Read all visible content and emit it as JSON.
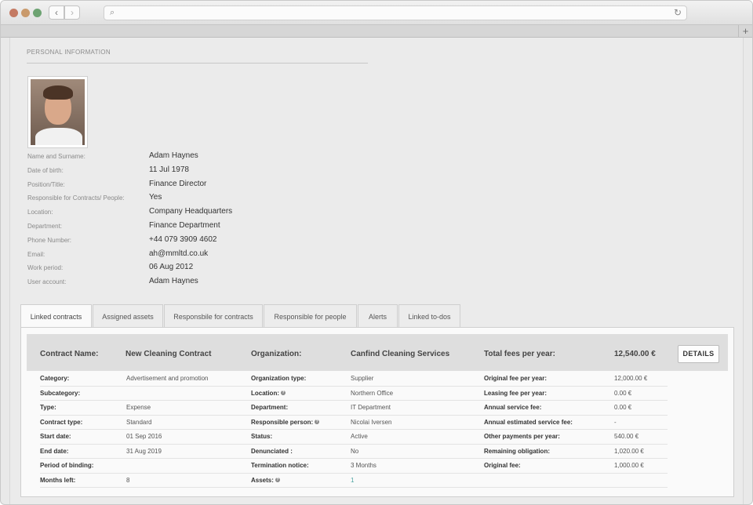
{
  "browser": {
    "back_glyph": "‹",
    "forward_glyph": "›",
    "search_glyph": "⌕",
    "reload_glyph": "↻",
    "new_tab_glyph": "+"
  },
  "section_title": "PERSONAL INFORMATION",
  "person": {
    "fields": [
      {
        "label": "Name and Surname:",
        "value": "Adam Haynes"
      },
      {
        "label": "Date of birth:",
        "value": "11 Jul 1978"
      },
      {
        "label": "Position/Title:",
        "value": "Finance Director"
      },
      {
        "label": "Responsible for Contracts/ People:",
        "value": "Yes"
      },
      {
        "label": "Location:",
        "value": "Company Headquarters"
      },
      {
        "label": "Department:",
        "value": "Finance Department"
      },
      {
        "label": "Phone Number:",
        "value": "+44 079 3909 4602"
      },
      {
        "label": "Email:",
        "value": "ah@mmltd.co.uk"
      },
      {
        "label": "Work period:",
        "value": "06 Aug 2012"
      },
      {
        "label": "User account:",
        "value": "Adam Haynes"
      }
    ]
  },
  "tabs": [
    {
      "label": "Linked contracts",
      "active": true
    },
    {
      "label": "Assigned assets"
    },
    {
      "label": "Responsbile for contracts"
    },
    {
      "label": "Responsible for people"
    },
    {
      "label": "Alerts"
    },
    {
      "label": "Linked to-dos"
    }
  ],
  "contract": {
    "name_label": "Contract Name:",
    "name_value": "New Cleaning Contract",
    "org_label": "Organization:",
    "org_value": "Canfind Cleaning Services",
    "fees_label": "Total fees per year:",
    "fees_value": "12,540.00 €",
    "details_button": "DETAILS"
  },
  "contract_rows": [
    [
      "Category:",
      "Advertisement and promotion",
      "Organization type:",
      "Supplier",
      "Original fee per year:",
      "12,000.00 €"
    ],
    [
      "Subcategory:",
      "",
      "Location:",
      "Northern Office",
      "Leasing fee per year:",
      "0.00 €"
    ],
    [
      "Type:",
      "Expense",
      "Department:",
      "IT Department",
      "Annual service fee:",
      "0.00 €"
    ],
    [
      "Contract type:",
      "Standard",
      "Responsible person:",
      "Nicolai Iversen",
      "Annual estimated service fee:",
      "-"
    ],
    [
      "Start date:",
      "01 Sep 2016",
      "Status:",
      "Active",
      "Other payments per year:",
      "540.00 €"
    ],
    [
      "End date:",
      "31 Aug 2019",
      "Denunciated :",
      "No",
      "Remaining obligation:",
      "1,020.00 €"
    ],
    [
      "Period of binding:",
      "",
      "Termination notice:",
      "3 Months",
      "Original fee:",
      "1,000.00 €"
    ],
    [
      "Months left:",
      "8",
      "Assets:",
      "1",
      "",
      ""
    ]
  ],
  "help_glyph": "?",
  "help_keys": [
    "Location:",
    "Responsible person:",
    "Assets:"
  ],
  "link_color": "#4aa3a0"
}
